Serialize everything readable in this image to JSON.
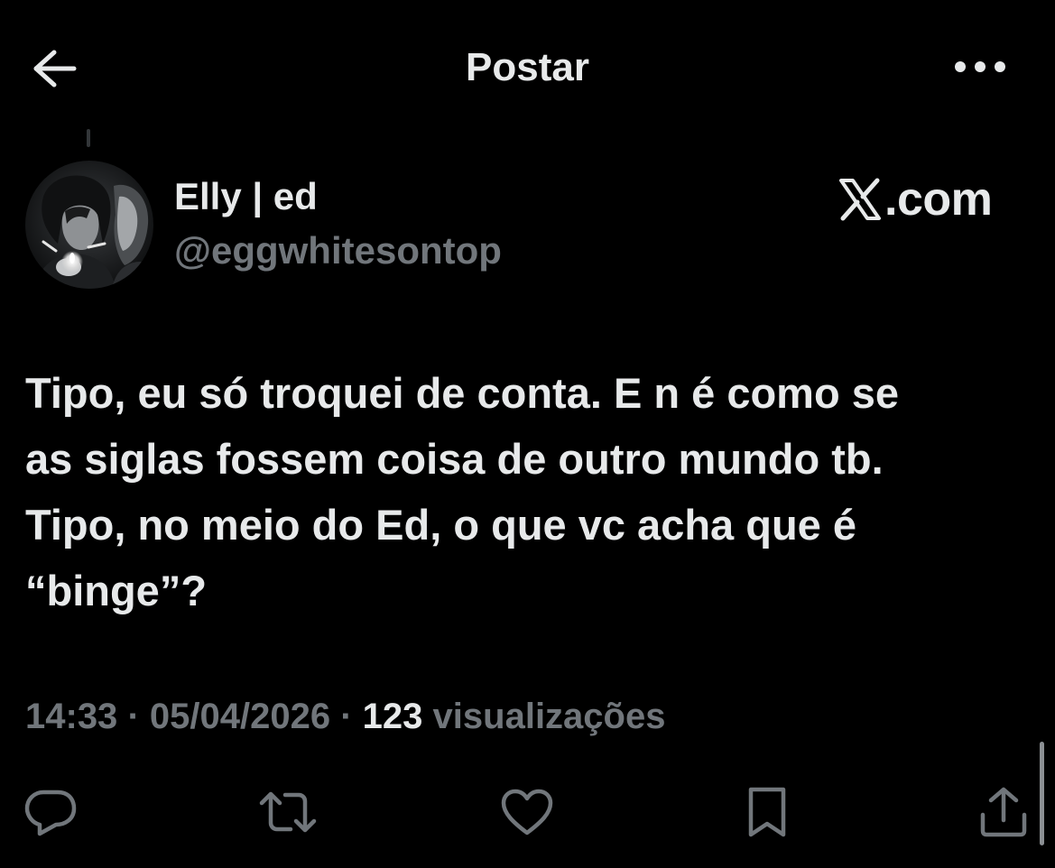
{
  "header": {
    "title": "Postar",
    "back_icon": "arrow-left-icon",
    "more_icon": "more-horizontal-icon"
  },
  "tweet": {
    "author": {
      "display_name": "Elly | ed",
      "handle": "@eggwhitesontop",
      "avatar_icon": "avatar-photo"
    },
    "source_logo": {
      "mark_icon": "x-logo-icon",
      "text": ".com"
    },
    "text": "Tipo, eu só troquei de conta. E n é como se\nas siglas fossem coisa de outro mundo tb.\nTipo, no meio do Ed, o que vc acha que é\n“binge”?",
    "time": "14:33",
    "date": "05/04/2026",
    "separator": "·",
    "views_count": "123",
    "views_label": "visualizações"
  },
  "actions": [
    {
      "name": "reply",
      "icon": "reply-icon"
    },
    {
      "name": "repost",
      "icon": "repost-icon"
    },
    {
      "name": "like",
      "icon": "heart-icon"
    },
    {
      "name": "bookmark",
      "icon": "bookmark-icon"
    },
    {
      "name": "share",
      "icon": "share-icon"
    }
  ],
  "colors": {
    "background": "#000000",
    "primary_text": "#e7e9ea",
    "secondary_text": "#71767b"
  }
}
